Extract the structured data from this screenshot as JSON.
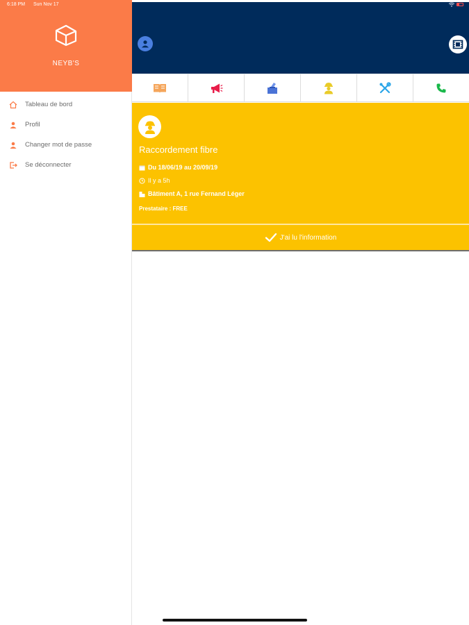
{
  "status_bar": {
    "time": "6:18 PM",
    "date": "Sun Nov 17"
  },
  "sidebar": {
    "brand": "NEYB'S",
    "menu": [
      {
        "label": "Tableau de bord",
        "icon": "home-icon"
      },
      {
        "label": "Profil",
        "icon": "user-icon"
      },
      {
        "label": "Changer mot de passe",
        "icon": "user-lock-icon"
      },
      {
        "label": "Se déconnecter",
        "icon": "logout-icon"
      }
    ]
  },
  "categories": [
    {
      "icon": "book-icon",
      "color": "#f5a55a"
    },
    {
      "icon": "megaphone-icon",
      "color": "#e81d4a"
    },
    {
      "icon": "ballot-box-icon",
      "color": "#4a73d6"
    },
    {
      "icon": "worker-icon",
      "color": "#e9cb28"
    },
    {
      "icon": "tools-icon",
      "color": "#2aa5e8"
    },
    {
      "icon": "phone-icon",
      "color": "#19b84a"
    }
  ],
  "notice": {
    "title": "Raccordement fibre",
    "dates": "Du 18/06/19 au 20/09/19",
    "ago": "Il y a 5h",
    "location": "Bâtiment A, 1 rue Fernand Léger",
    "provider": "Prestataire : FREE",
    "ack_label": "J'ai lu l'information"
  },
  "colors": {
    "sidebar_header": "#fb7b48",
    "topbar": "#002b5b",
    "card": "#fcc200",
    "accent_icon": "#fb7b48"
  }
}
